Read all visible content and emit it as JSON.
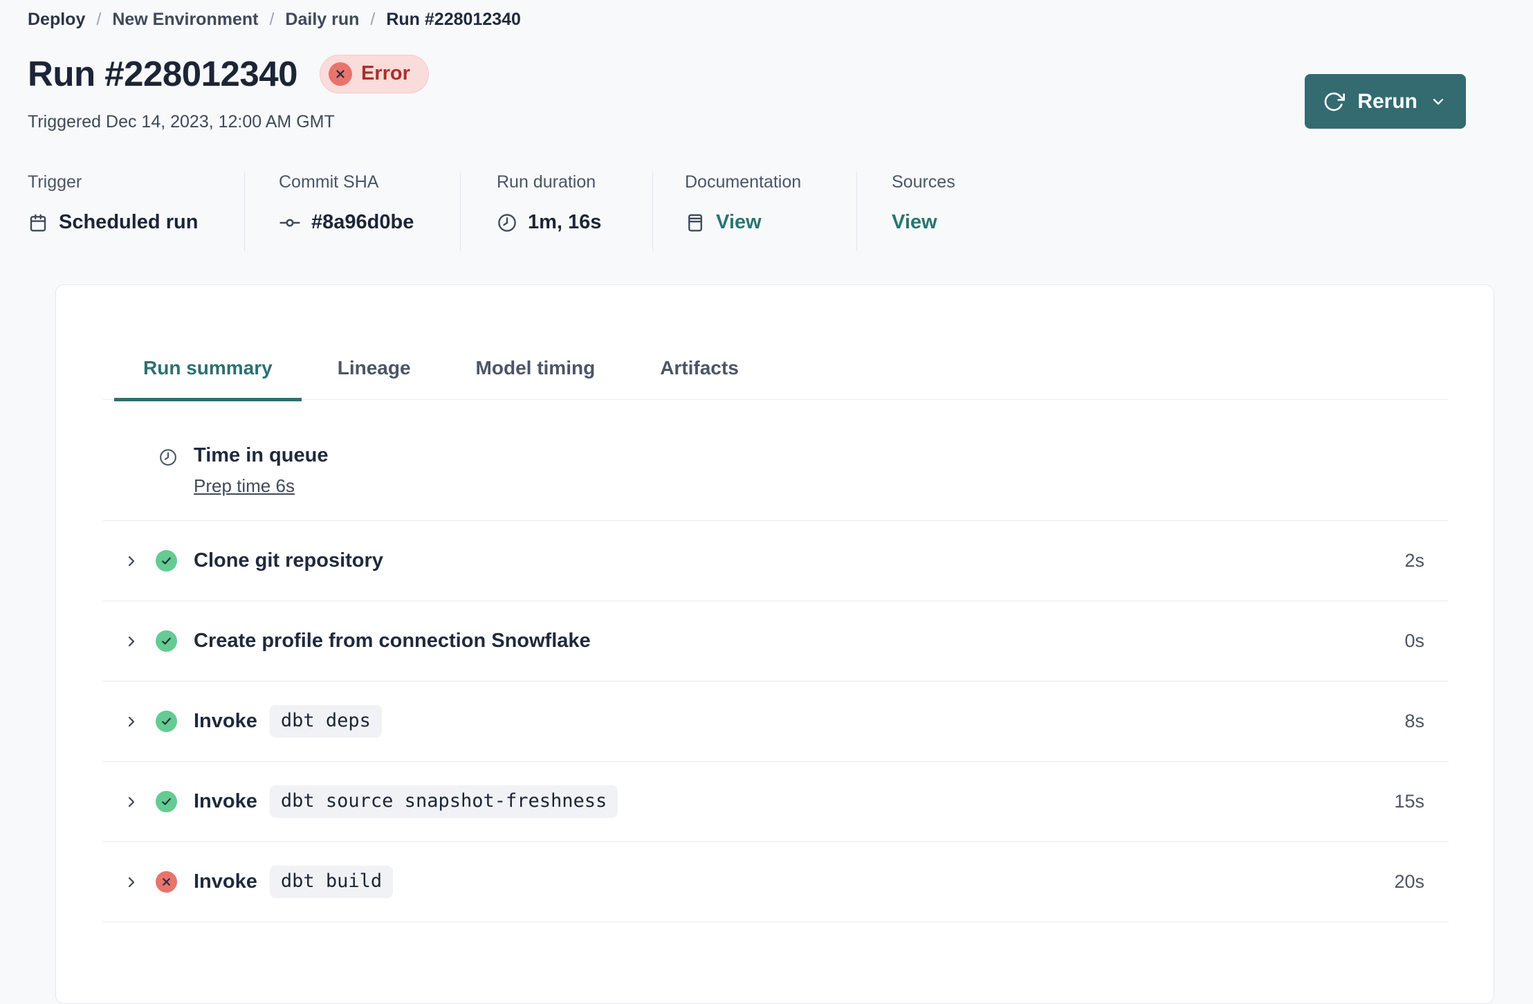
{
  "breadcrumb": {
    "separator": "/",
    "items": [
      "Deploy",
      "New Environment",
      "Daily run",
      "Run #228012340"
    ]
  },
  "header": {
    "title": "Run #228012340",
    "status": "Error",
    "triggered": "Triggered Dec 14, 2023, 12:00 AM GMT",
    "rerun_label": "Rerun"
  },
  "meta": {
    "columns": [
      {
        "label": "Trigger",
        "value": "Scheduled run",
        "icon": "calendar-icon"
      },
      {
        "label": "Commit SHA",
        "value": "#8a96d0be",
        "icon": "commit-icon"
      },
      {
        "label": "Run duration",
        "value": "1m, 16s",
        "icon": "clock-icon"
      },
      {
        "label": "Documentation",
        "value": "View",
        "icon": "book-icon"
      },
      {
        "label": "Sources",
        "value": "View"
      }
    ]
  },
  "tabs": [
    {
      "label": "Run summary",
      "active": true
    },
    {
      "label": "Lineage",
      "active": false
    },
    {
      "label": "Model timing",
      "active": false
    },
    {
      "label": "Artifacts",
      "active": false
    }
  ],
  "queue": {
    "title": "Time in queue",
    "link": "Prep time 6s",
    "icon": "clock-icon"
  },
  "steps": [
    {
      "status": "success",
      "label": "Clone git repository",
      "duration": "2s"
    },
    {
      "status": "success",
      "label": "Create profile from connection Snowflake",
      "duration": "0s"
    },
    {
      "status": "success",
      "label": "Invoke",
      "command": "dbt deps",
      "duration": "8s"
    },
    {
      "status": "success",
      "label": "Invoke",
      "command": "dbt source snapshot-freshness",
      "duration": "15s"
    },
    {
      "status": "error",
      "label": "Invoke",
      "command": "dbt build",
      "duration": "20s"
    }
  ],
  "colors": {
    "accent_teal": "#2e6f70",
    "button_teal": "#336b71",
    "link_teal": "#26766f",
    "success_green": "#64cb92",
    "error_salmon": "#e8746c",
    "error_badge_bg": "#fadcda",
    "error_text": "#ab2f2d",
    "text_dark": "#1f2a3c",
    "text_slate": "#4b5565",
    "divider": "#e8eaee",
    "page_bg": "#f8f9fb",
    "card_bg": "#ffffff",
    "chip_bg": "#f1f2f5"
  }
}
